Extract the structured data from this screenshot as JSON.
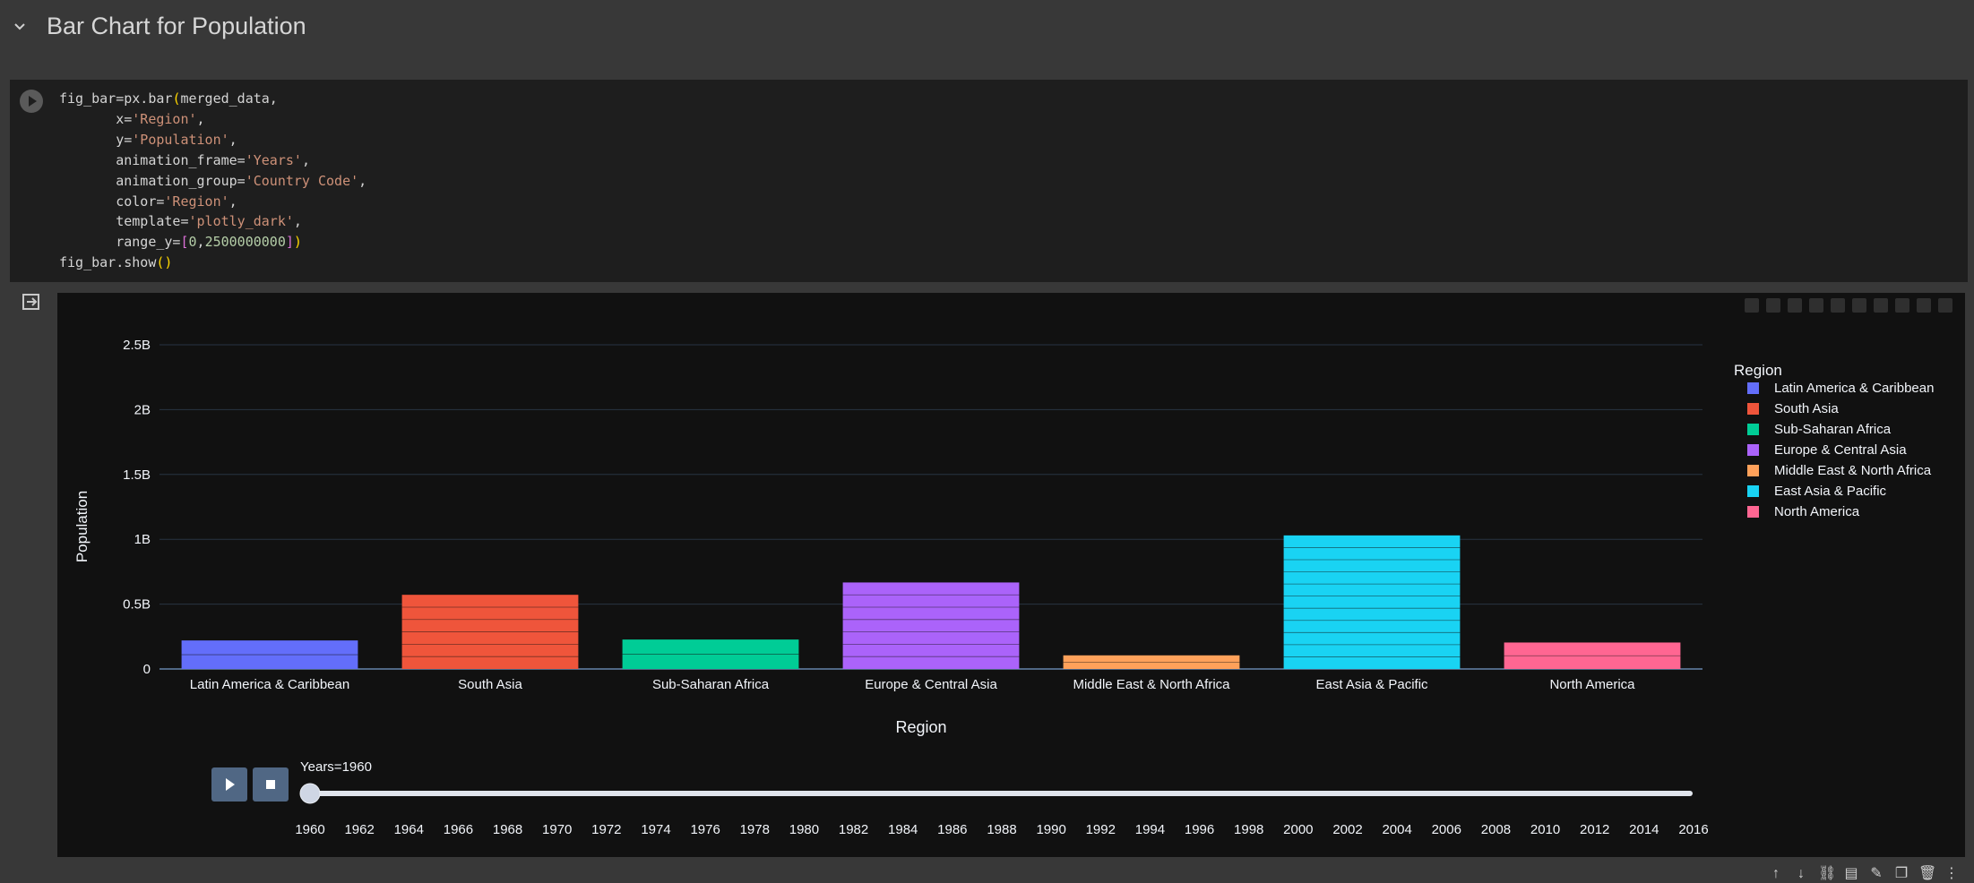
{
  "section": {
    "title": "Bar Chart for Population"
  },
  "code_lines": [
    "fig_bar=px.bar(merged_data,",
    "       x='Region',",
    "       y='Population',",
    "       animation_frame='Years',",
    "       animation_group='Country Code',",
    "       color='Region',",
    "       template='plotly_dark',",
    "       range_y=[0,2500000000])",
    "fig_bar.show()"
  ],
  "chart_data": {
    "type": "bar",
    "xlabel": "Region",
    "ylabel": "Population",
    "ylim": [
      0,
      2500000000
    ],
    "yticks": [
      {
        "value": 0,
        "label": "0"
      },
      {
        "value": 500000000,
        "label": "0.5B"
      },
      {
        "value": 1000000000,
        "label": "1B"
      },
      {
        "value": 1500000000,
        "label": "1.5B"
      },
      {
        "value": 2000000000,
        "label": "2B"
      },
      {
        "value": 2500000000,
        "label": "2.5B"
      }
    ],
    "grid": true,
    "legend_title": "Region",
    "legend_position": "right",
    "categories": [
      "Latin America & Caribbean",
      "South Asia",
      "Sub-Saharan Africa",
      "Europe & Central Asia",
      "Middle East & North Africa",
      "East Asia & Pacific",
      "North America"
    ],
    "series": [
      {
        "name": "Latin America & Caribbean",
        "color": "#636efa",
        "value": 220000000
      },
      {
        "name": "South Asia",
        "color": "#ef553b",
        "value": 572000000
      },
      {
        "name": "Sub-Saharan Africa",
        "color": "#00cc96",
        "value": 227000000
      },
      {
        "name": "Europe & Central Asia",
        "color": "#ab63fa",
        "value": 667000000
      },
      {
        "name": "Middle East & North Africa",
        "color": "#ffa15a",
        "value": 105000000
      },
      {
        "name": "East Asia & Pacific",
        "color": "#19d3f3",
        "value": 1030000000
      },
      {
        "name": "North America",
        "color": "#ff6692",
        "value": 204000000
      }
    ],
    "animation": {
      "current_label": "Years=1960",
      "years": [
        "1960",
        "1962",
        "1964",
        "1966",
        "1968",
        "1970",
        "1972",
        "1974",
        "1976",
        "1978",
        "1980",
        "1982",
        "1984",
        "1986",
        "1988",
        "1990",
        "1992",
        "1994",
        "1996",
        "1998",
        "2000",
        "2002",
        "2004",
        "2006",
        "2008",
        "2010",
        "2012",
        "2014",
        "2016"
      ],
      "current_index": 0
    }
  },
  "footer_icons": [
    "move-up-icon",
    "move-down-icon",
    "link-icon",
    "comment-icon",
    "edit-icon",
    "copy-icon",
    "delete-icon",
    "more-icon"
  ]
}
